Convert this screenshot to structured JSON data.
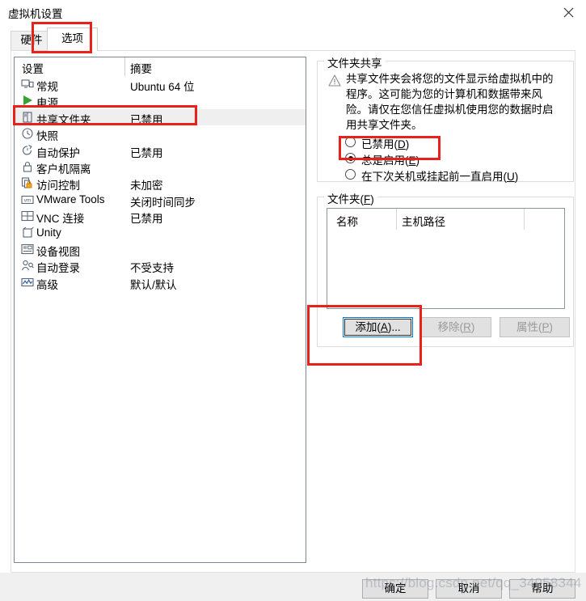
{
  "window": {
    "title": "虚拟机设置",
    "close_icon": "close-icon"
  },
  "tabs": [
    {
      "label": "硬件",
      "name": "tab-hardware",
      "active": false
    },
    {
      "label": "选项",
      "name": "tab-options",
      "active": true
    }
  ],
  "settings_list": {
    "headers": {
      "name": "设置",
      "summary": "摘要"
    },
    "rows": [
      {
        "icon": "monitor-icon",
        "label": "常规",
        "summary": "Ubuntu 64 位",
        "selected": false
      },
      {
        "icon": "power-play-icon",
        "label": "电源",
        "summary": "",
        "selected": false
      },
      {
        "icon": "shared-folder-icon",
        "label": "共享文件夹",
        "summary": "已禁用",
        "selected": true
      },
      {
        "icon": "snapshot-icon",
        "label": "快照",
        "summary": "",
        "selected": false
      },
      {
        "icon": "autoprotect-icon",
        "label": "自动保护",
        "summary": "已禁用",
        "selected": false
      },
      {
        "icon": "lock-icon",
        "label": "客户机隔离",
        "summary": "",
        "selected": false
      },
      {
        "icon": "access-control-icon",
        "label": "访问控制",
        "summary": "未加密",
        "selected": false
      },
      {
        "icon": "vmware-tools-icon",
        "label": "VMware Tools",
        "summary": "关闭时间同步",
        "selected": false
      },
      {
        "icon": "vnc-icon",
        "label": "VNC 连接",
        "summary": "已禁用",
        "selected": false
      },
      {
        "icon": "unity-icon",
        "label": "Unity",
        "summary": "",
        "selected": false
      },
      {
        "icon": "device-view-icon",
        "label": "设备视图",
        "summary": "",
        "selected": false
      },
      {
        "icon": "autologin-icon",
        "label": "自动登录",
        "summary": "不受支持",
        "selected": false
      },
      {
        "icon": "advanced-icon",
        "label": "高级",
        "summary": "默认/默认",
        "selected": false
      }
    ]
  },
  "sharing": {
    "group_title": "文件夹共享",
    "warning_icon": "warning-triangle-icon",
    "warning_text": "共享文件夹会将您的文件显示给虚拟机中的程序。这可能为您的计算机和数据带来风险。请仅在您信任虚拟机使用您的数据时启用共享文件夹。",
    "options": [
      {
        "label": "已禁用",
        "accel": "D",
        "checked": false,
        "name": "radio-disabled"
      },
      {
        "label": "总是启用",
        "accel": "E",
        "checked": true,
        "name": "radio-always"
      },
      {
        "label": "在下次关机或挂起前一直启用",
        "accel": "U",
        "checked": false,
        "name": "radio-untilexit"
      }
    ]
  },
  "folders": {
    "group_title": "文件夹",
    "group_accel": "F",
    "columns": [
      "名称",
      "主机路径"
    ],
    "rows": [],
    "buttons": [
      {
        "label": "添加",
        "accel": "A",
        "suffix": "...",
        "state": "focused",
        "name": "add-folder-button"
      },
      {
        "label": "移除",
        "accel": "R",
        "suffix": "",
        "state": "disabled",
        "name": "remove-folder-button"
      },
      {
        "label": "属性",
        "accel": "P",
        "suffix": "",
        "state": "disabled",
        "name": "folder-properties-button"
      }
    ]
  },
  "footer": {
    "ok": "确定",
    "cancel": "取消",
    "help": "帮助"
  },
  "watermark": "https://blog.csdn.net/qq_34958344",
  "colors": {
    "annotation_red": "#e8211a",
    "focus_blue": "#0078d7",
    "selection_grey": "#efefef",
    "power_green": "#35a335"
  }
}
